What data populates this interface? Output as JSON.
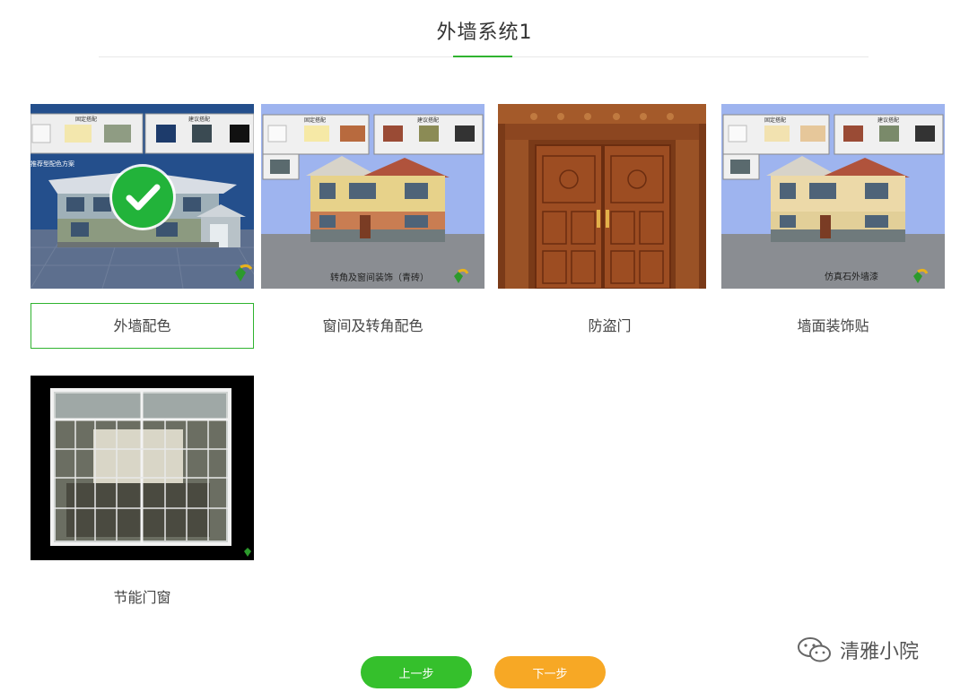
{
  "page": {
    "title": "外墙系统1"
  },
  "options": [
    {
      "label": "外墙配色",
      "selected": true,
      "image_text": {
        "top_left": "固定搭配",
        "top_right": "建议搭配",
        "side": "推荐型配色方案"
      }
    },
    {
      "label": "窗间及转角配色",
      "selected": false,
      "image_text": {
        "top_left": "固定搭配",
        "top_right": "建议搭配",
        "caption": "转角及窗间装饰（青砖）"
      }
    },
    {
      "label": "防盗门",
      "selected": false,
      "image_text": {}
    },
    {
      "label": "墙面装饰贴",
      "selected": false,
      "image_text": {
        "top_left": "固定搭配",
        "top_right": "建议搭配",
        "caption": "仿真石外墙漆"
      }
    },
    {
      "label": "节能门窗",
      "selected": false,
      "image_text": {}
    }
  ],
  "buttons": {
    "prev": "上一步",
    "next": "下一步"
  },
  "watermark": {
    "text": "清雅小院",
    "icon": "wechat-icon"
  },
  "colors": {
    "accent_green": "#2fb32f",
    "prev_button": "#35c02c",
    "next_button": "#f7a825",
    "check_badge": "#22b33a"
  }
}
